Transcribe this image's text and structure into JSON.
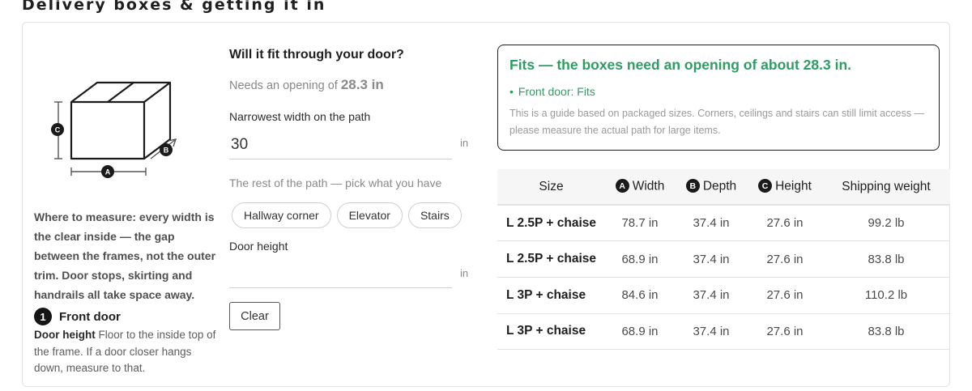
{
  "section_title": "Delivery boxes & getting it in",
  "illustration": {
    "labels": {
      "a": "A",
      "b": "B",
      "c": "C"
    }
  },
  "measure_note": "Where to measure: every width is the clear inside — the gap between the frames, not the outer trim. Door stops, skirting and handrails all take space away.",
  "step": {
    "number": "1",
    "label": "Front door",
    "desc_bold": "Door height",
    "desc_text": "Floor to the inside top of the frame. If a door closer hangs down, measure to that."
  },
  "fit_title": "Will it fit through your door?",
  "needs_text": "Needs an opening of",
  "needs_value": "28.3 in",
  "width_field": {
    "label": "Narrowest width on the path",
    "value": "30",
    "unit": "in"
  },
  "rest_label": "The rest of the path — pick what you have",
  "chips": [
    "Hallway corner",
    "Elevator",
    "Stairs"
  ],
  "height_field": {
    "label": "Door height",
    "value": "",
    "unit": "in"
  },
  "clear_label": "Clear",
  "result": {
    "title": "Fits — the boxes need an opening of about 28.3 in.",
    "item": "Front door: Fits",
    "note": "This is a guide based on packaged sizes. Corners, ceilings and stairs can still limit access — please measure the actual path for large items."
  },
  "table": {
    "headers": {
      "size": "Size",
      "width_badge": "A",
      "width": "Width",
      "depth_badge": "B",
      "depth": "Depth",
      "height_badge": "C",
      "height": "Height",
      "weight": "Shipping weight"
    },
    "rows": [
      [
        "L 2.5P + chaise",
        "78.7 in",
        "37.4 in",
        "27.6 in",
        "99.2 lb"
      ],
      [
        "L 2.5P + chaise",
        "68.9 in",
        "37.4 in",
        "27.6 in",
        "83.8 lb"
      ],
      [
        "L 3P + chaise",
        "84.6 in",
        "37.4 in",
        "27.6 in",
        "110.2 lb"
      ],
      [
        "L 3P + chaise",
        "68.9 in",
        "37.4 in",
        "27.6 in",
        "83.8 lb"
      ]
    ]
  },
  "colors": {
    "fit_green": "#2e9c63",
    "ink": "#1b1b1b",
    "muted": "#8a8a8a"
  }
}
